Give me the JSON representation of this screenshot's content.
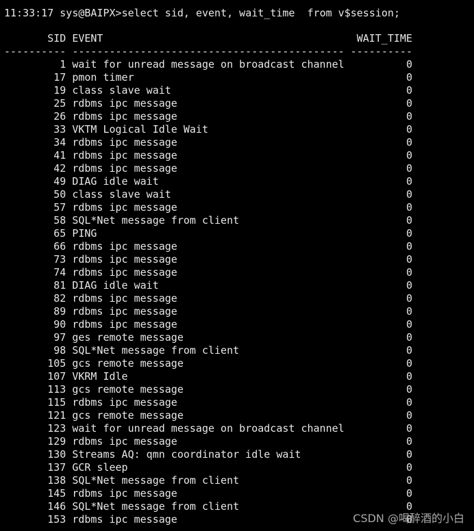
{
  "prompt_line": "11:33:17 sys@BAIPX>select sid, event, wait_time  from v$session;",
  "headers": {
    "sid": "SID",
    "event": "EVENT",
    "wait_time": "WAIT_TIME"
  },
  "separator": {
    "sid": "----------",
    "event": "--------------------------------------------",
    "wait_time": "----------"
  },
  "rows": [
    {
      "sid": "1",
      "event": "wait for unread message on broadcast channel",
      "wait_time": "0"
    },
    {
      "sid": "17",
      "event": "pmon timer",
      "wait_time": "0"
    },
    {
      "sid": "19",
      "event": "class slave wait",
      "wait_time": "0"
    },
    {
      "sid": "25",
      "event": "rdbms ipc message",
      "wait_time": "0"
    },
    {
      "sid": "26",
      "event": "rdbms ipc message",
      "wait_time": "0"
    },
    {
      "sid": "33",
      "event": "VKTM Logical Idle Wait",
      "wait_time": "0"
    },
    {
      "sid": "34",
      "event": "rdbms ipc message",
      "wait_time": "0"
    },
    {
      "sid": "41",
      "event": "rdbms ipc message",
      "wait_time": "0"
    },
    {
      "sid": "42",
      "event": "rdbms ipc message",
      "wait_time": "0"
    },
    {
      "sid": "49",
      "event": "DIAG idle wait",
      "wait_time": "0"
    },
    {
      "sid": "50",
      "event": "class slave wait",
      "wait_time": "0"
    },
    {
      "sid": "57",
      "event": "rdbms ipc message",
      "wait_time": "0"
    },
    {
      "sid": "58",
      "event": "SQL*Net message from client",
      "wait_time": "0"
    },
    {
      "sid": "65",
      "event": "PING",
      "wait_time": "0"
    },
    {
      "sid": "66",
      "event": "rdbms ipc message",
      "wait_time": "0"
    },
    {
      "sid": "73",
      "event": "rdbms ipc message",
      "wait_time": "0"
    },
    {
      "sid": "74",
      "event": "rdbms ipc message",
      "wait_time": "0"
    },
    {
      "sid": "81",
      "event": "DIAG idle wait",
      "wait_time": "0"
    },
    {
      "sid": "82",
      "event": "rdbms ipc message",
      "wait_time": "0"
    },
    {
      "sid": "89",
      "event": "rdbms ipc message",
      "wait_time": "0"
    },
    {
      "sid": "90",
      "event": "rdbms ipc message",
      "wait_time": "0"
    },
    {
      "sid": "97",
      "event": "ges remote message",
      "wait_time": "0"
    },
    {
      "sid": "98",
      "event": "SQL*Net message from client",
      "wait_time": "0"
    },
    {
      "sid": "105",
      "event": "gcs remote message",
      "wait_time": "0"
    },
    {
      "sid": "107",
      "event": "VKRM Idle",
      "wait_time": "0"
    },
    {
      "sid": "113",
      "event": "gcs remote message",
      "wait_time": "0"
    },
    {
      "sid": "115",
      "event": "rdbms ipc message",
      "wait_time": "0"
    },
    {
      "sid": "121",
      "event": "gcs remote message",
      "wait_time": "0"
    },
    {
      "sid": "123",
      "event": "wait for unread message on broadcast channel",
      "wait_time": "0"
    },
    {
      "sid": "129",
      "event": "rdbms ipc message",
      "wait_time": "0"
    },
    {
      "sid": "130",
      "event": "Streams AQ: qmn coordinator idle wait",
      "wait_time": "0"
    },
    {
      "sid": "137",
      "event": "GCR sleep",
      "wait_time": "0"
    },
    {
      "sid": "138",
      "event": "SQL*Net message from client",
      "wait_time": "0"
    },
    {
      "sid": "145",
      "event": "rdbms ipc message",
      "wait_time": "0"
    },
    {
      "sid": "146",
      "event": "SQL*Net message from client",
      "wait_time": "0"
    },
    {
      "sid": "153",
      "event": "rdbms ipc message",
      "wait_time": "0"
    }
  ],
  "watermark": "CSDN @喝醉酒的小白"
}
